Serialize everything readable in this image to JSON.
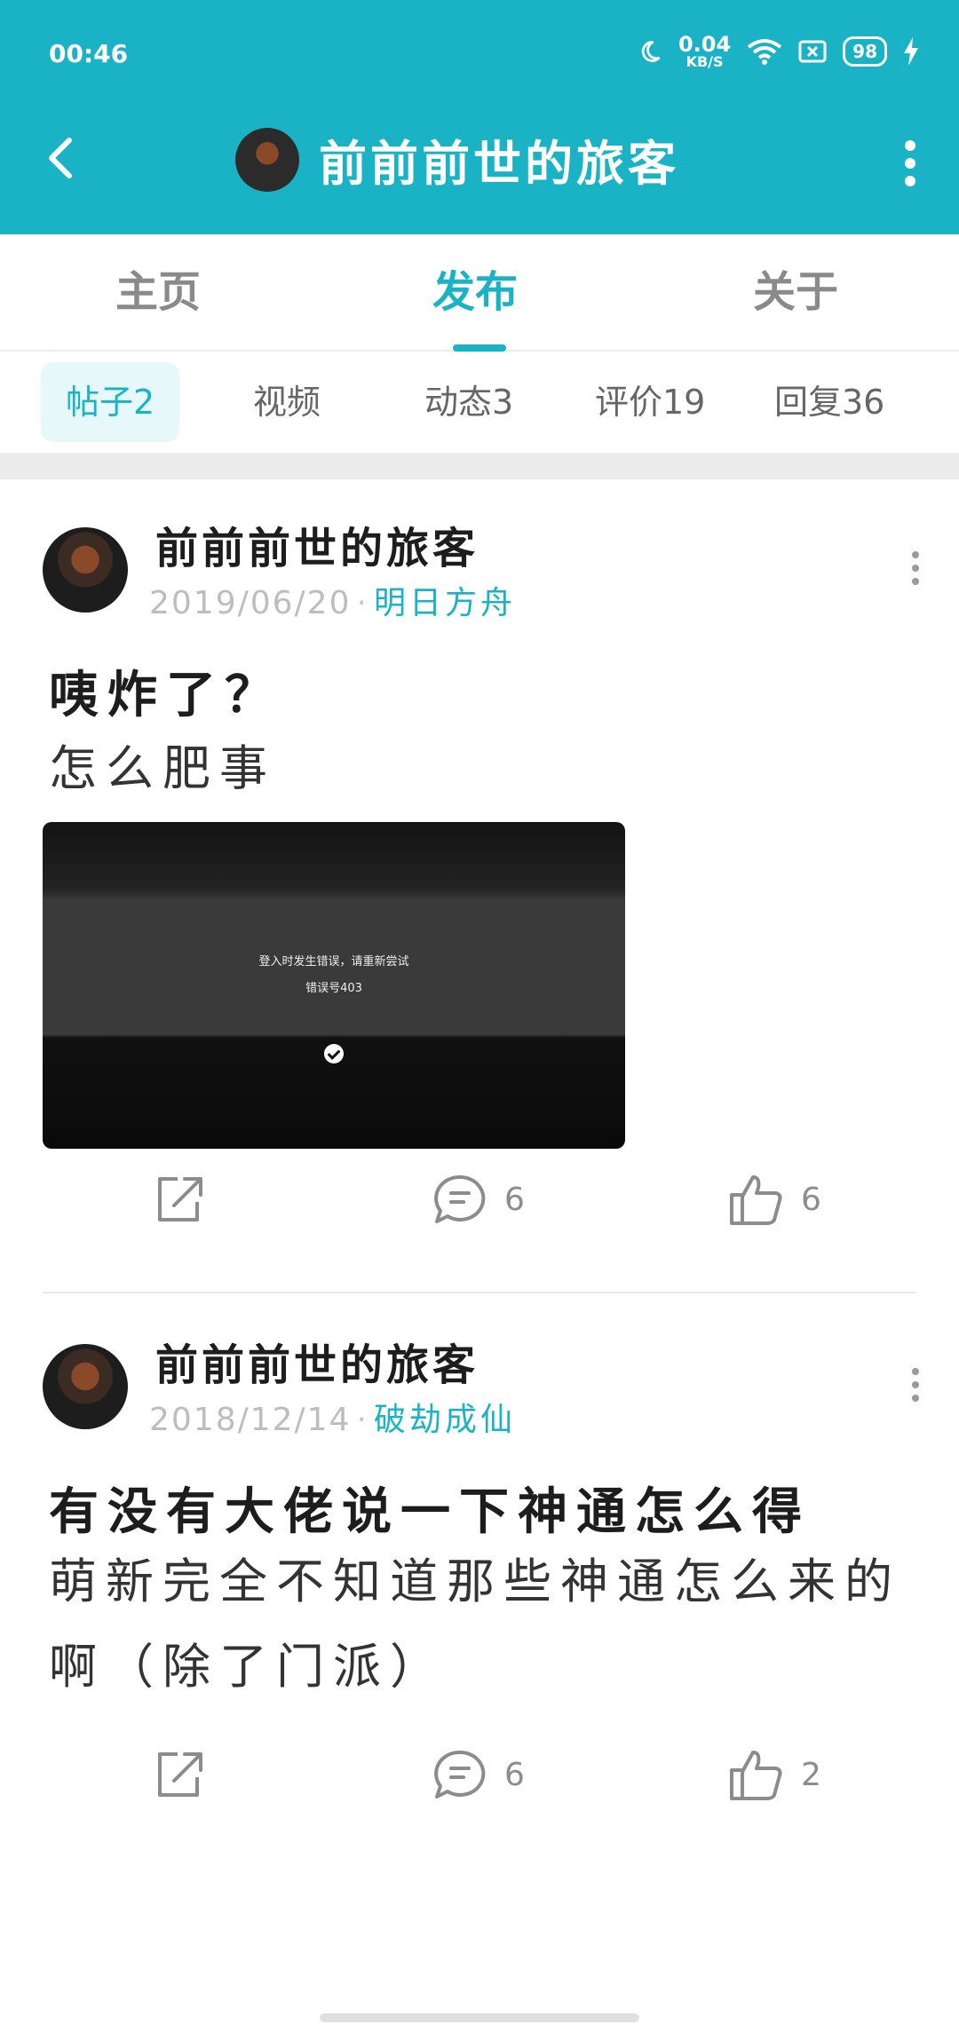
{
  "status_bar": {
    "time": "00:46",
    "net_speed_value": "0.04",
    "net_speed_unit": "KB/S",
    "battery": "98",
    "icons": [
      "moon-icon",
      "wifi-icon",
      "sim-icon",
      "battery-icon",
      "charging-icon"
    ]
  },
  "header": {
    "title": "前前前世的旅客",
    "bg_color": "#1ab3c5"
  },
  "tabs": [
    {
      "label": "主页",
      "active": false
    },
    {
      "label": "发布",
      "active": true
    },
    {
      "label": "关于",
      "active": false
    }
  ],
  "subtabs": [
    {
      "label": "帖子2",
      "active": true
    },
    {
      "label": "视频",
      "active": false
    },
    {
      "label": "动态3",
      "active": false
    },
    {
      "label": "评价19",
      "active": false
    },
    {
      "label": "回复36",
      "active": false
    }
  ],
  "posts": [
    {
      "author": "前前前世的旅客",
      "date": "2019/06/20",
      "board": "明日方舟",
      "title": "咦炸了？",
      "body": "怎么肥事",
      "image_text_1": "登入时发生错误，请重新尝试",
      "image_text_2": "错误号403",
      "comments": "6",
      "likes": "6"
    },
    {
      "author": "前前前世的旅客",
      "date": "2018/12/14",
      "board": "破劫成仙",
      "title": "有没有大佬说一下神通怎么得",
      "body": "萌新完全不知道那些神通怎么来的啊（除了门派）",
      "comments": "6",
      "likes": "2"
    }
  ]
}
